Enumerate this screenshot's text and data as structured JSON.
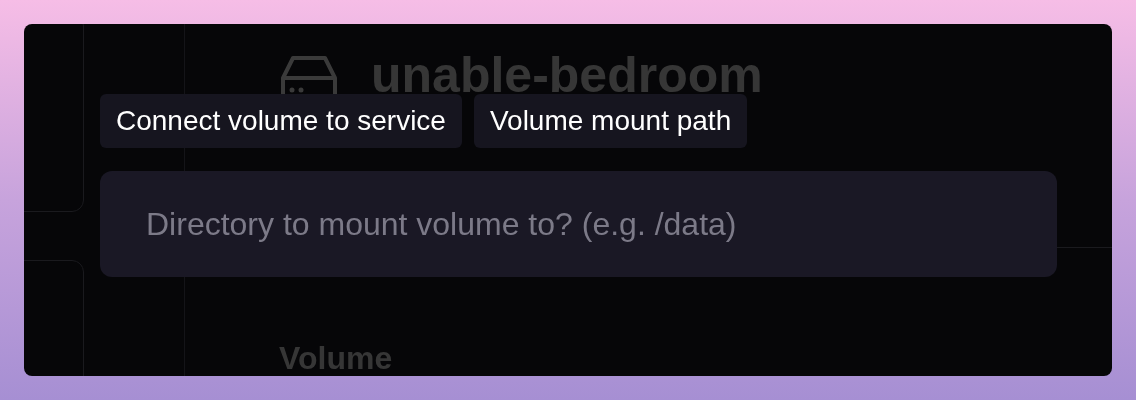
{
  "background": {
    "title": "unable-bedroom",
    "section_heading": "Volume"
  },
  "breadcrumbs": [
    {
      "label": "Connect volume to service"
    },
    {
      "label": "Volume mount path"
    }
  ],
  "mount_path_field": {
    "placeholder": "Directory to mount volume to? (e.g. /data)"
  }
}
